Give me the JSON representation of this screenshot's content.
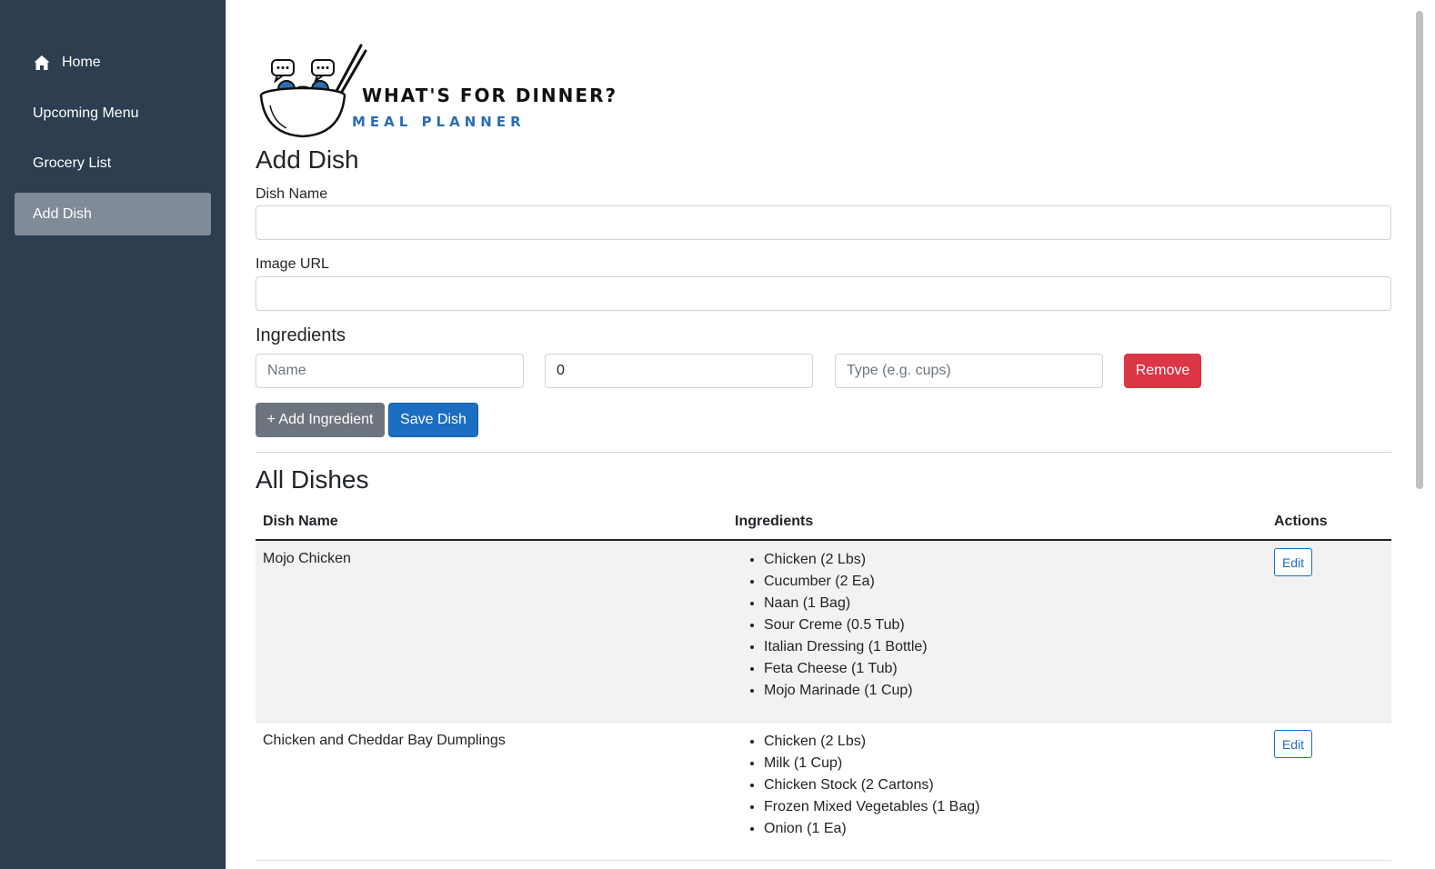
{
  "sidebar": {
    "items": [
      {
        "label": "Home",
        "icon": "home-icon"
      },
      {
        "label": "Upcoming Menu"
      },
      {
        "label": "Grocery List"
      },
      {
        "label": "Add Dish",
        "active": true
      }
    ]
  },
  "logo": {
    "title": "WHAT'S FOR DINNER?",
    "subtitle": "MEAL PLANNER"
  },
  "form": {
    "title": "Add Dish",
    "dish_name_label": "Dish Name",
    "dish_name_value": "",
    "image_url_label": "Image URL",
    "image_url_value": "",
    "ingredients_title": "Ingredients",
    "ingredient_row": {
      "name_placeholder": "Name",
      "name_value": "",
      "quantity_value": "0",
      "type_placeholder": "Type (e.g. cups)",
      "type_value": "",
      "remove_label": "Remove"
    },
    "add_ingredient_label": "+ Add Ingredient",
    "save_label": "Save Dish"
  },
  "dishes": {
    "title": "All Dishes",
    "columns": [
      "Dish Name",
      "Ingredients",
      "Actions"
    ],
    "rows": [
      {
        "name": "Mojo Chicken",
        "ingredients": [
          "Chicken (2 Lbs)",
          "Cucumber (2 Ea)",
          "Naan (1 Bag)",
          "Sour Creme (0.5 Tub)",
          "Italian Dressing (1 Bottle)",
          "Feta Cheese (1 Tub)",
          "Mojo Marinade (1 Cup)"
        ],
        "action": "Edit"
      },
      {
        "name": "Chicken and Cheddar Bay Dumplings",
        "ingredients": [
          "Chicken (2 Lbs)",
          "Milk (1 Cup)",
          "Chicken Stock (2 Cartons)",
          "Frozen Mixed Vegetables (1 Bag)",
          "Onion (1 Ea)"
        ],
        "action": "Edit"
      }
    ]
  },
  "colors": {
    "sidebar_bg": "#2c3e50",
    "sidebar_active": "#7f8c97",
    "primary": "#1b6ec2",
    "secondary": "#6c757d",
    "danger": "#dc3545",
    "logo_blue": "#2a6db5"
  }
}
